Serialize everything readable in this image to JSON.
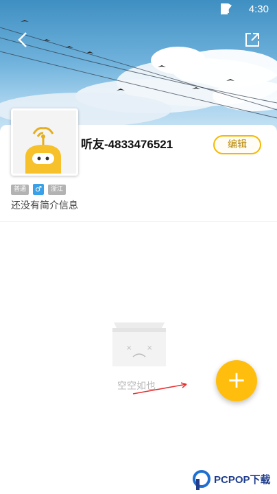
{
  "status_bar": {
    "time": "4:30"
  },
  "profile": {
    "username": "听友-4833476521",
    "edit_label": "编辑",
    "tags": {
      "level": "普通",
      "gender_symbol": "♂",
      "region": "浙江"
    },
    "bio": "还没有简介信息"
  },
  "empty_state": {
    "text": "空空如也"
  },
  "fab": {
    "label": "+"
  },
  "watermark": {
    "text": "PCPOP下载"
  },
  "colors": {
    "accent": "#ffbe0d",
    "edit_border": "#f5b800",
    "gender": "#3aa0e8"
  }
}
